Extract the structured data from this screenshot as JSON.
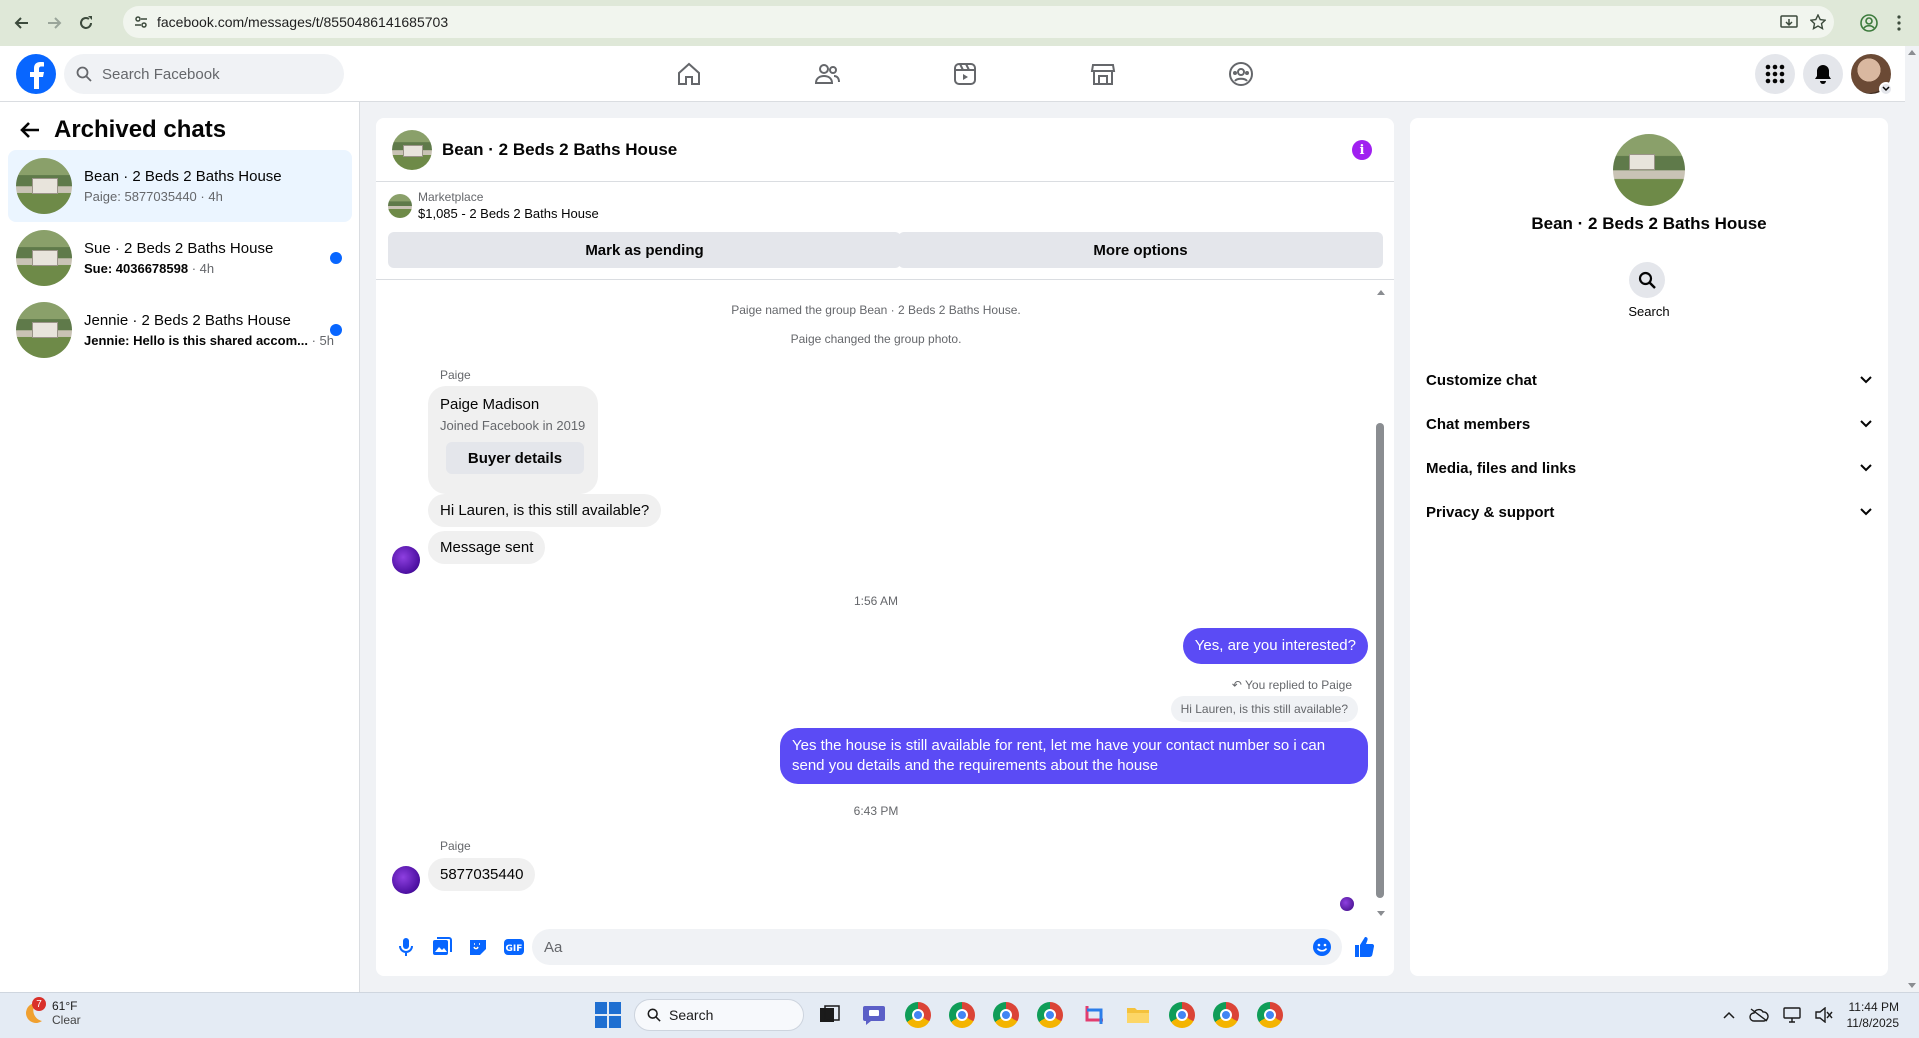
{
  "browser": {
    "url": "facebook.com/messages/t/8550486141685703"
  },
  "header": {
    "search_placeholder": "Search Facebook"
  },
  "sidebar": {
    "title": "Archived chats",
    "chats": [
      {
        "name": "Bean · 2 Beds 2 Baths House",
        "preview": "Paige: 5877035440",
        "time": "4h",
        "unread": false,
        "active": true
      },
      {
        "name": "Sue · 2 Beds 2 Baths House",
        "preview": "Sue: 4036678598",
        "time": "4h",
        "unread": true,
        "active": false
      },
      {
        "name": "Jennie · 2 Beds 2 Baths House",
        "preview": "Jennie: Hello is this shared accom...",
        "time": "5h",
        "unread": true,
        "active": false
      }
    ]
  },
  "chat": {
    "title": "Bean · 2 Beds 2 Baths House",
    "marketplace_label": "Marketplace",
    "listing": "$1,085 - 2 Beds 2 Baths House",
    "mark_pending": "Mark as pending",
    "more_options": "More options",
    "system_1": "Paige named the group Bean · 2 Beds 2 Baths House.",
    "system_2": "Paige changed the group photo.",
    "sender_name": "Paige",
    "card_name": "Paige Madison",
    "card_joined": "Joined Facebook in 2019",
    "card_button": "Buyer details",
    "msg_1": "Hi Lauren, is this still available?",
    "msg_2": "Message sent",
    "time_1": "1:56 AM",
    "out_1": "Yes, are you interested?",
    "reply_note": "You replied to Paige",
    "reply_quote": "Hi Lauren, is this still available?",
    "out_2": "Yes the house is still available for rent, let me have your contact number so i can send you details and the requirements about the house",
    "time_2": "6:43 PM",
    "sender_name_2": "Paige",
    "msg_3": "5877035440",
    "composer_placeholder": "Aa"
  },
  "details": {
    "name": "Bean · 2 Beds 2 Baths House",
    "search_label": "Search",
    "sections": [
      "Customize chat",
      "Chat members",
      "Media, files and links",
      "Privacy & support"
    ]
  },
  "taskbar": {
    "temp": "61°F",
    "condition": "Clear",
    "weather_badge": "7",
    "search_label": "Search",
    "time": "11:44 PM",
    "date": "11/8/2025"
  },
  "colors": {
    "accent": "#0866ff",
    "outgoing_bubble": "#5b4bf5",
    "info_icon": "#a020f0"
  }
}
